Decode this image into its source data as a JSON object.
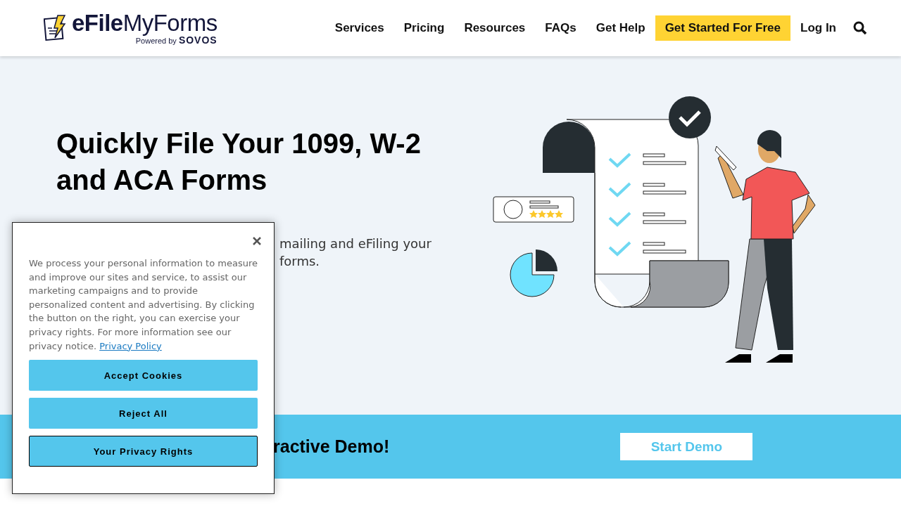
{
  "header": {
    "logo": {
      "brand_bold": "eFile",
      "brand_light": "MyForms",
      "tagline_prefix": "Powered by",
      "tagline_brand": "SOVOS"
    },
    "nav": [
      {
        "label": "Services",
        "kind": "link"
      },
      {
        "label": "Pricing",
        "kind": "link"
      },
      {
        "label": "Resources",
        "kind": "link"
      },
      {
        "label": "FAQs",
        "kind": "link"
      },
      {
        "label": "Get Help",
        "kind": "link"
      },
      {
        "label": "Get Started For Free",
        "kind": "cta"
      },
      {
        "label": "Log In",
        "kind": "link"
      }
    ]
  },
  "hero": {
    "title": "Quickly File Your 1099, W-2 and ACA Forms",
    "description_visible": [
      "mailing and eFiling your",
      "forms."
    ]
  },
  "demo_banner": {
    "text_visible": "ractive Demo!",
    "button": "Start Demo"
  },
  "cookie_dialog": {
    "text": "We process your personal information to measure and improve our sites and service, to assist our marketing campaigns and to provide personalized content and advertising. By clicking the button on the right, you can exercise your privacy rights. For more information see our privacy notice.",
    "link": "Privacy Policy",
    "buttons": [
      {
        "label": "Accept Cookies",
        "outlined": false
      },
      {
        "label": "Reject All",
        "outlined": false
      },
      {
        "label": "Your Privacy Rights",
        "outlined": true
      }
    ]
  }
}
